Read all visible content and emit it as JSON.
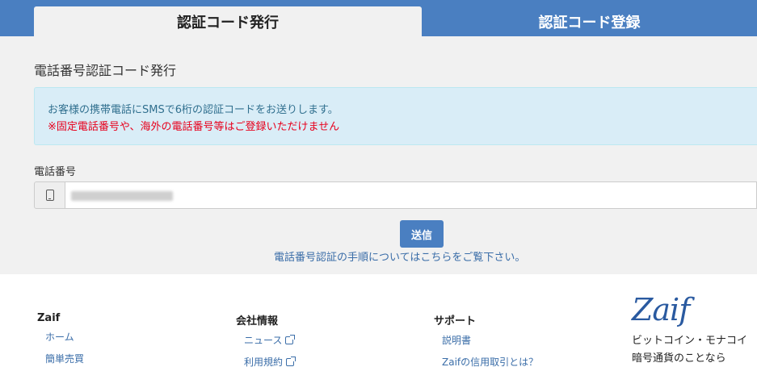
{
  "tabs": {
    "active": "認証コード発行",
    "inactive": "認証コード登録"
  },
  "section_title": "電話番号認証コード発行",
  "info": {
    "line1": "お客様の携帯電話にSMSで6桁の認証コードをお送りします。",
    "line2": "※固定電話番号や、海外の電話番号等はご登録いただけません"
  },
  "phone": {
    "label": "電話番号",
    "icon": "mobile-phone-icon"
  },
  "send_label": "送信",
  "help_link": "電話番号認証の手順についてはこちらをご覧下さい。",
  "footer": {
    "zaif": {
      "heading": "Zaif",
      "links": [
        "ホーム",
        "簡単売買"
      ]
    },
    "company": {
      "heading": "会社情報",
      "links": [
        "ニュース",
        "利用規約"
      ]
    },
    "support": {
      "heading": "サポート",
      "links": [
        "説明書",
        "Zaifの信用取引とは？"
      ]
    },
    "logo": "Zaif",
    "tagline1": "ビットコイン・モナコイ",
    "tagline2": "暗号通貨のことなら"
  },
  "colors": {
    "brand_blue": "#4a7fc1",
    "info_bg": "#d9edf7",
    "warning_red": "#e8001c",
    "link_blue": "#3a6da8"
  }
}
